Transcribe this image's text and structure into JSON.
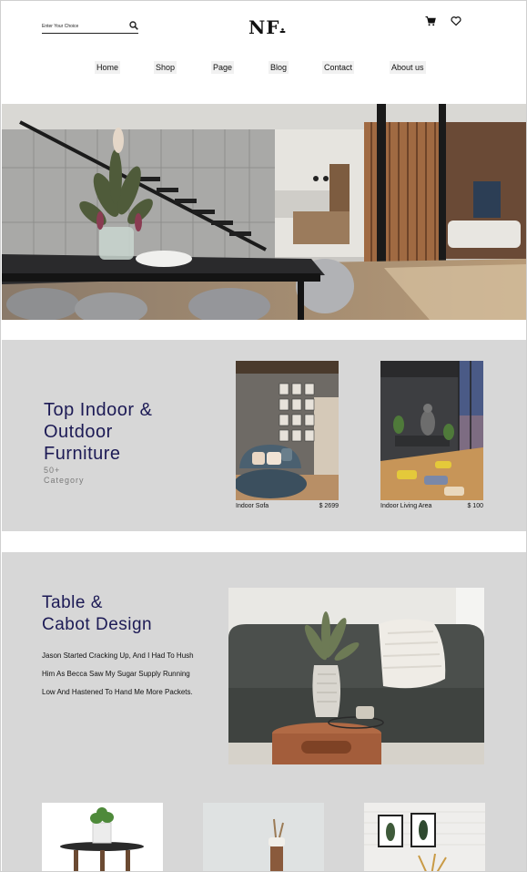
{
  "header": {
    "search_placeholder": "Enter Your Choice",
    "logo": "NF",
    "icons": [
      "search-icon",
      "cart-icon",
      "heart-icon"
    ]
  },
  "nav": {
    "items": [
      "Home",
      "Shop",
      "Page",
      "Blog",
      "Contact",
      "About us"
    ]
  },
  "categories": {
    "title_lines": [
      "Top Indoor &",
      "Outdoor",
      "Furniture"
    ],
    "count": "50+",
    "count_label": "Category",
    "products": [
      {
        "name": "Indoor Sofa",
        "price": "$ 2699"
      },
      {
        "name": "Indoor Living Area",
        "price": "$ 100"
      }
    ]
  },
  "feature": {
    "title_lines": [
      "Table &",
      "Cabot Design"
    ],
    "body": "Jason Started Cracking Up, And I Had To Hush Him As Becca Saw My Sugar Supply Running Low And Hastened To Hand Me More Packets."
  },
  "colors": {
    "accent": "#1c1a55",
    "section_bg": "#d7d7d7"
  }
}
